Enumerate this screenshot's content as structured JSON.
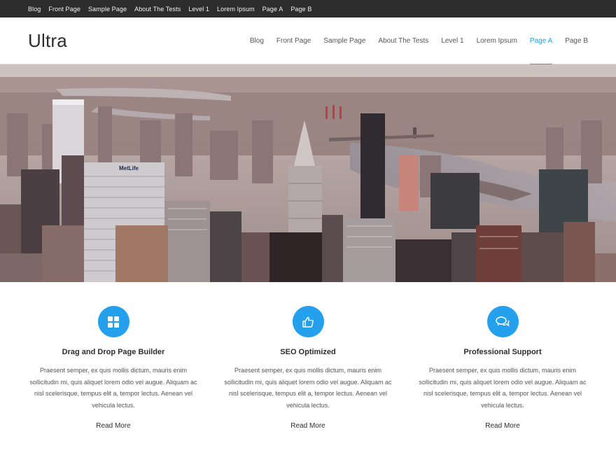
{
  "topbar": {
    "items": [
      "Blog",
      "Front Page",
      "Sample Page",
      "About The Tests",
      "Level 1",
      "Lorem Ipsum",
      "Page A",
      "Page B"
    ]
  },
  "header": {
    "site_title": "Ultra",
    "nav": [
      "Blog",
      "Front Page",
      "Sample Page",
      "About The Tests",
      "Level 1",
      "Lorem Ipsum",
      "Page A",
      "Page B"
    ],
    "active_item": "Page A"
  },
  "hero": {
    "image": "city-skyline-aerial",
    "sign_text": "MetLife"
  },
  "features": [
    {
      "icon": "grid-icon",
      "title": "Drag and Drop Page Builder",
      "text": "Praesent semper, ex quis mollis dictum, mauris enim sollicitudin mi, quis aliquet lorem odio vel augue. Aliquam ac nisl scelerisque, tempus elit a, tempor lectus. Aenean vel vehicula lectus.",
      "link": "Read More"
    },
    {
      "icon": "thumbs-up-icon",
      "title": "SEO Optimized",
      "text": "Praesent semper, ex quis mollis dictum, mauris enim sollicitudin mi, quis aliquet lorem odio vel augue. Aliquam ac nisl scelerisque, tempus elit a, tempor lectus. Aenean vel vehicula lectus.",
      "link": "Read More"
    },
    {
      "icon": "chat-bubbles-icon",
      "title": "Professional Support",
      "text": "Praesent semper, ex quis mollis dictum, mauris enim sollicitudin mi, quis aliquet lorem odio vel augue. Aliquam ac nisl scelerisque, tempus elit a, tempor lectus. Aenean vel vehicula lectus.",
      "link": "Read More"
    }
  ],
  "colors": {
    "accent": "#24a0ed",
    "topbar_bg": "#2d2d2d",
    "text_dark": "#2d2d2d",
    "text_body": "#555555"
  }
}
